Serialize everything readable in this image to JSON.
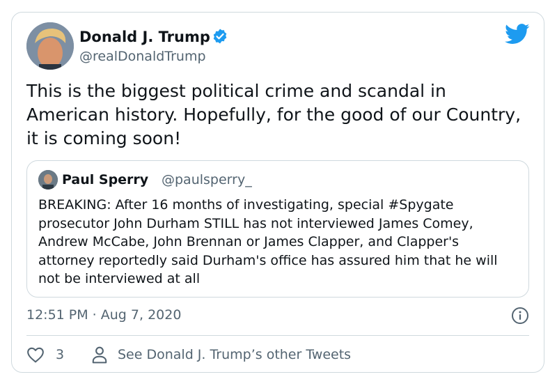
{
  "author": {
    "name": "Donald J. Trump",
    "handle": "@realDonaldTrump",
    "verified": true
  },
  "tweet": {
    "text": "This is the biggest political crime and scandal in American history. Hopefully, for the good of our Country, it is coming soon!",
    "timestamp": "12:51 PM · Aug 7, 2020"
  },
  "quoted_tweet": {
    "name": "Paul Sperry",
    "handle": "@paulsperry_",
    "text": "BREAKING: After 16 months of investigating, special #Spygate prosecutor John Durham STILL has not interviewed James Comey, Andrew McCabe, John Brennan or James Clapper, and Clapper's attorney reportedly said Durham's office has assured him that he will not be interviewed at all"
  },
  "footer": {
    "like_count": "3",
    "other_tweets_label": "See Donald J. Trump’s other Tweets"
  },
  "icons": {
    "brand": "twitter-bird-icon",
    "verified": "verified-badge-icon",
    "info": "info-icon",
    "like": "heart-icon",
    "profile": "person-icon"
  },
  "colors": {
    "twitter_blue": "#1d9bf0",
    "text_primary": "#0f1419",
    "text_secondary": "#536471",
    "border": "#cfd9de"
  }
}
